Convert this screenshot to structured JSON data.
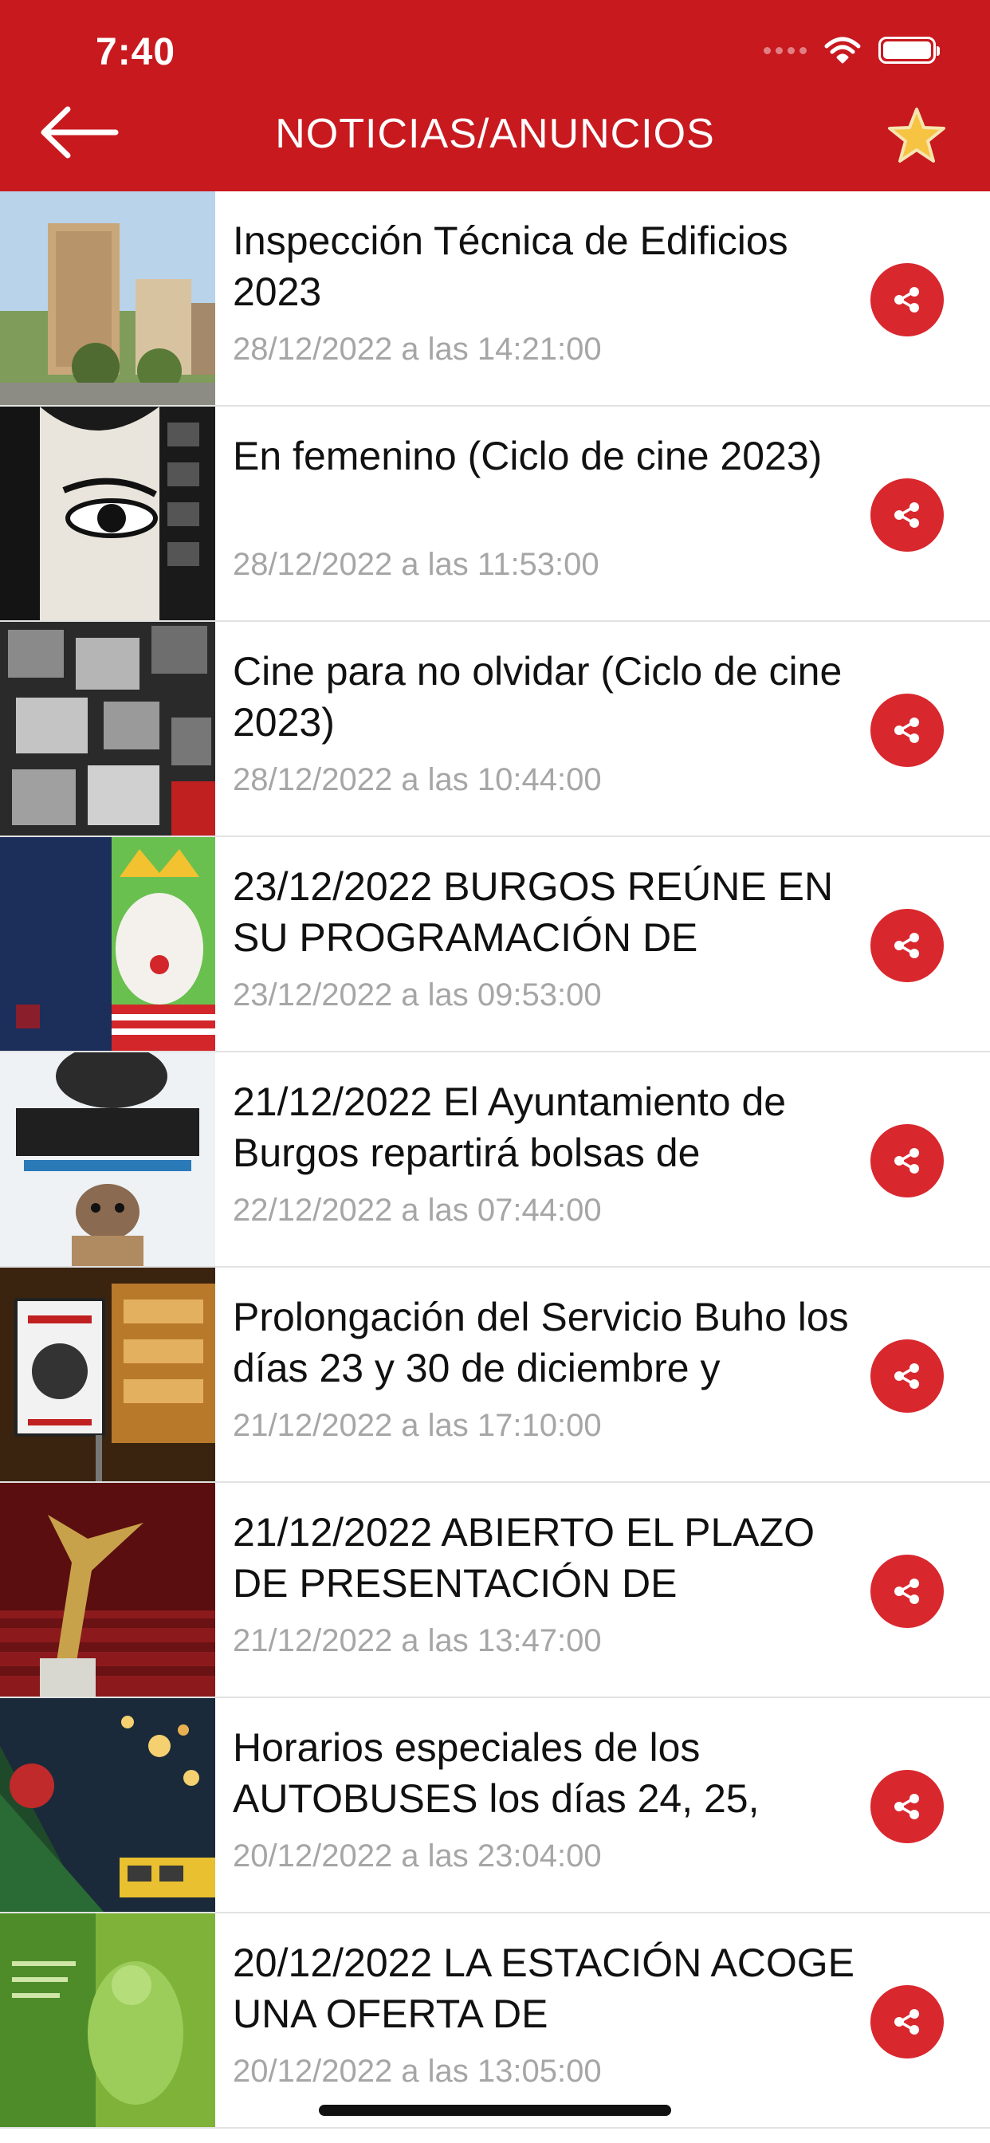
{
  "status_bar": {
    "time": "7:40"
  },
  "header": {
    "title": "NOTICIAS/ANUNCIOS",
    "back_icon": "arrow-left-icon",
    "favorite_icon": "star-icon"
  },
  "colors": {
    "header_bg": "#c8191f",
    "share_button": "#d9272e",
    "star": "#f6c343",
    "date_text": "#a6a6a6"
  },
  "news": [
    {
      "title": "Inspección Técnica de Edificios 2023",
      "date": "28/12/2022 a las 14:21:00",
      "thumbnail": "buildings-photo"
    },
    {
      "title": "En femenino (Ciclo de cine 2023)",
      "date": "28/12/2022 a las 11:53:00",
      "thumbnail": "woman-eye-film-poster"
    },
    {
      "title": "Cine para no olvidar (Ciclo de cine 2023)",
      "date": "28/12/2022 a las 10:44:00",
      "thumbnail": "film-strip-collage"
    },
    {
      "title": "23/12/2022 BURGOS REÚNE EN SU PROGRAMACIÓN DE",
      "date": "23/12/2022 a las 09:53:00",
      "thumbnail": "navidad-2022-burgos-poster"
    },
    {
      "title": "21/12/2022 El Ayuntamiento de Burgos repartirá bolsas de",
      "date": "22/12/2022 a las 07:44:00",
      "thumbnail": "adopta-dog-poster"
    },
    {
      "title": "Prolongación del Servicio Buho los días 23 y 30 de diciembre y",
      "date": "21/12/2022 a las 17:10:00",
      "thumbnail": "servicio-buho-sign"
    },
    {
      "title": "21/12/2022 ABIERTO EL PLAZO DE PRESENTACIÓN DE",
      "date": "21/12/2022 a las 13:47:00",
      "thumbnail": "theatre-award-statue"
    },
    {
      "title": "Horarios especiales de los AUTOBUSES los días 24, 25,",
      "date": "20/12/2022 a las 23:04:00",
      "thumbnail": "christmas-tree-bus"
    },
    {
      "title": "20/12/2022 LA ESTACIÓN ACOGE UNA OFERTA DE",
      "date": "20/12/2022 a las 13:05:00",
      "thumbnail": "vr-green-poster"
    }
  ]
}
